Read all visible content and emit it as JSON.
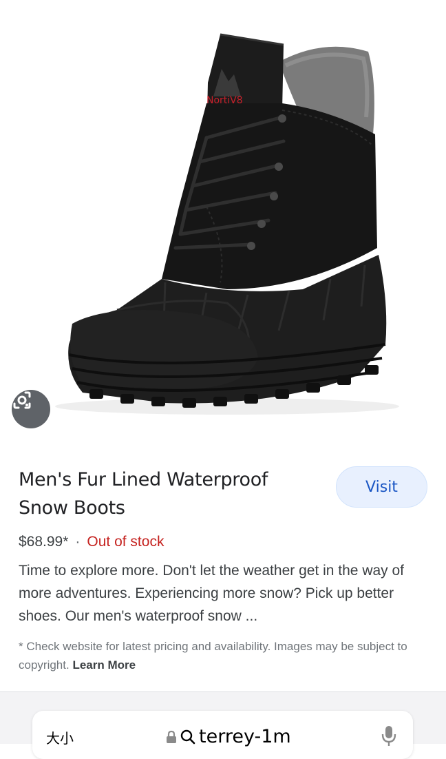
{
  "product": {
    "title": "Men's Fur Lined Waterproof Snow Boots",
    "visit_label": "Visit",
    "price": "$68.99*",
    "separator": "·",
    "stock_status": "Out of stock",
    "description": "Time to explore more. Don't let the weather get in the way of more adventures. Experiencing more snow? Pick up better shoes. Our men's waterproof snow ...",
    "disclaimer": "* Check website for latest pricing and availability. Images may be subject to copyright.",
    "learn_more_label": "Learn More",
    "brand_logo_text": "NortiV8"
  },
  "browser": {
    "text_size_label": "大小",
    "url": "terrey-1m"
  },
  "icons": {
    "lens": "google-lens-icon",
    "lock": "lock-icon",
    "search": "search-icon",
    "mic": "microphone-icon"
  },
  "colors": {
    "stock_red": "#c5221f",
    "visit_bg": "#e8f0fe",
    "visit_text": "#1a56c4",
    "boot_black": "#161616",
    "fur_gray": "#7b7b7b"
  }
}
